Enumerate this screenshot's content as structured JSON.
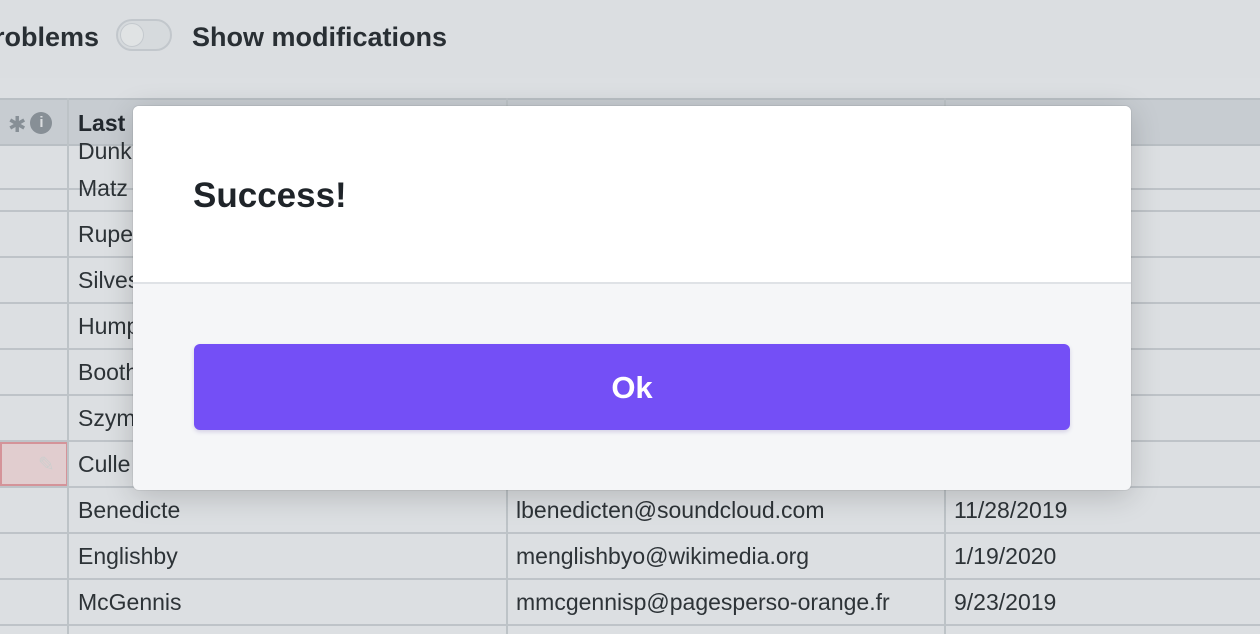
{
  "toolbar": {
    "problems_label": "roblems",
    "show_modifications_label": "Show modifications",
    "show_modifications_on": false
  },
  "table": {
    "columns": [
      "Last"
    ],
    "header_icons": [
      "asterisk-icon",
      "info-icon"
    ],
    "rows": [
      {
        "last": "Dunk",
        "email": "",
        "date": ""
      },
      {
        "last": "Matz",
        "email": "",
        "date": ""
      },
      {
        "last": "Rupe",
        "email": "",
        "date": ""
      },
      {
        "last": "Silves",
        "email": "",
        "date": ""
      },
      {
        "last": "Hump",
        "email": "",
        "date": ""
      },
      {
        "last": "Booth",
        "email": "",
        "date": ""
      },
      {
        "last": "Szym",
        "email": "",
        "date": ""
      },
      {
        "last": "Culle",
        "email": "",
        "date": ""
      },
      {
        "last": "Benedicte",
        "email": "lbenedicten@soundcloud.com",
        "date": "11/28/2019"
      },
      {
        "last": "Englishby",
        "email": "menglishbyo@wikimedia.org",
        "date": "1/19/2020"
      },
      {
        "last": "McGennis",
        "email": "mmcgennisp@pagesperso-orange.fr",
        "date": "9/23/2019"
      }
    ]
  },
  "modal": {
    "title": "Success!",
    "ok_label": "Ok"
  },
  "colors": {
    "accent": "#744ff6",
    "error_cell": "#edd7d9"
  }
}
